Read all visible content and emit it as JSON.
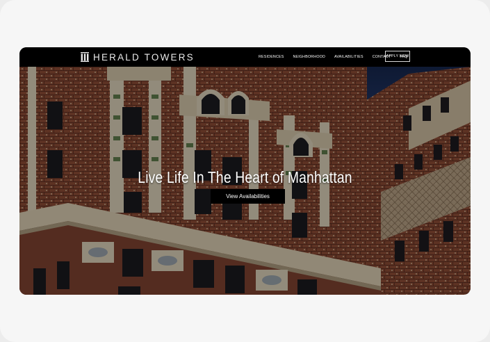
{
  "brand": {
    "name": "HERALD TOWERS",
    "logo_icon": "building-columns-icon"
  },
  "nav": {
    "items": [
      {
        "label": "RESIDENCES"
      },
      {
        "label": "NEIGHBORHOOD"
      },
      {
        "label": "AVAILABILITIES"
      },
      {
        "label": "CONTACT"
      },
      {
        "label": "FAQ"
      }
    ],
    "cta_label": "APPLY NOW"
  },
  "hero": {
    "headline": "Live Life In The Heart of Manhattan",
    "button_label": "View Availabilities",
    "image": "photo of historic brick building with ornate terracotta windows against blue sky"
  },
  "colors": {
    "nav_bg": "#000000",
    "page_bg": "#f6f6f6",
    "text": "#ffffff"
  }
}
